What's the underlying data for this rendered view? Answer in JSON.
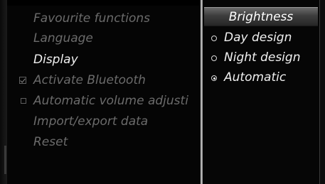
{
  "left_menu": {
    "items": [
      {
        "label": "Favourite functions",
        "state": "dimmed",
        "icon": null
      },
      {
        "label": "Language",
        "state": "dimmed",
        "icon": null
      },
      {
        "label": "Display",
        "state": "active",
        "icon": null
      },
      {
        "label": "Activate Bluetooth",
        "state": "dimmed",
        "icon": "checked-checkbox-icon"
      },
      {
        "label": "Automatic volume adjusti",
        "state": "dimmed",
        "icon": "checkbox-icon"
      },
      {
        "label": "Import/export data",
        "state": "dimmed",
        "icon": null
      },
      {
        "label": "Reset",
        "state": "dimmed",
        "icon": null
      }
    ]
  },
  "right_panel": {
    "title": "Brightness",
    "options": [
      {
        "label": "Day design",
        "selected": false,
        "icon": "radio-empty-icon"
      },
      {
        "label": "Night design",
        "selected": false,
        "icon": "radio-empty-icon"
      },
      {
        "label": "Automatic",
        "selected": true,
        "icon": "radio-selected-icon"
      }
    ]
  },
  "colors": {
    "background": "#000000",
    "active_text": "#f0f0f0",
    "dimmed_text": "#6b6b6b",
    "divider": "#b0b0b0"
  }
}
